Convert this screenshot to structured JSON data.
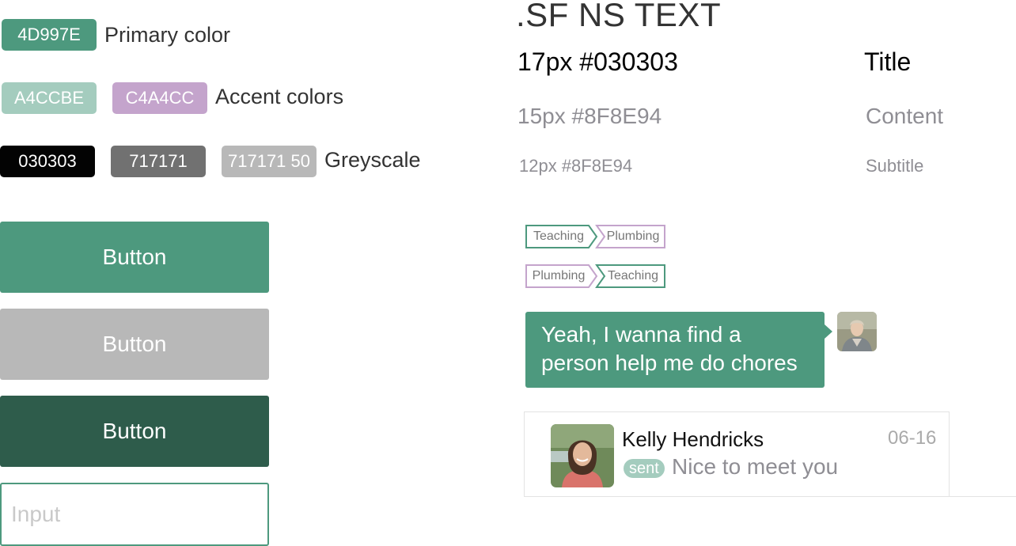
{
  "colors": {
    "primary": "#4D997E",
    "accent1": "#A4CCBE",
    "accent2": "#C4A4CC",
    "black": "#030303",
    "grey": "#717171",
    "grey50": "#B8B8B8",
    "button_dark": "#2E5C4B",
    "button_grey": "#B8B8B8",
    "text_grey": "#8F8E94"
  },
  "swatches": {
    "primary": {
      "code": "4D997E",
      "label": "Primary color"
    },
    "accent": {
      "codes": [
        "A4CCBE",
        "C4A4CC"
      ],
      "label": "Accent colors"
    },
    "greyscale": {
      "codes": [
        "030303",
        "717171",
        "717171 50"
      ],
      "label": "Greyscale"
    }
  },
  "buttons": {
    "primary_label": "Button",
    "disabled_label": "Button",
    "pressed_label": "Button"
  },
  "input": {
    "placeholder": "Input"
  },
  "typography": {
    "font_heading": ".SF NS TEXT",
    "rows": [
      {
        "spec": "17px #030303",
        "role": "Title"
      },
      {
        "spec": "15px #8F8E94",
        "role": "Content"
      },
      {
        "spec": "12px #8F8E94",
        "role": "Subtitle"
      }
    ]
  },
  "tags": {
    "row1": [
      "Teaching",
      "Plumbing"
    ],
    "row2": [
      "Plumbing",
      "Teaching"
    ]
  },
  "chat": {
    "message_line1": "Yeah, I wanna find a",
    "message_line2": "person help me do chores"
  },
  "conversation": {
    "name": "Kelly Hendricks",
    "date": "06-16",
    "status": "sent",
    "message": "Nice to meet you"
  }
}
